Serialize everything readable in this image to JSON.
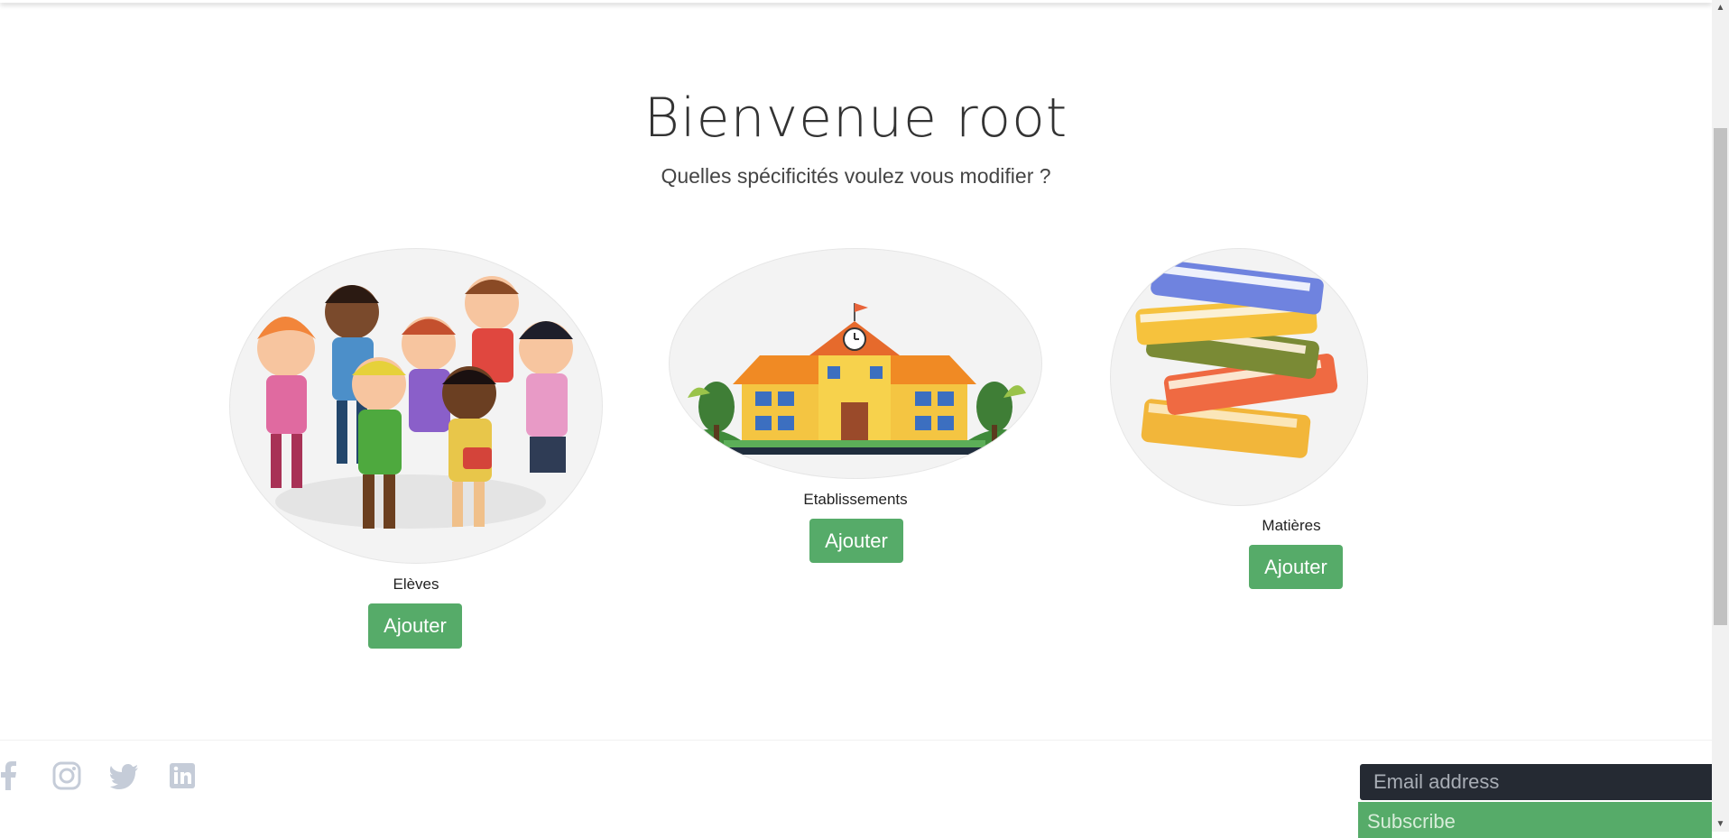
{
  "hero": {
    "title": "Bienvenue root",
    "subtitle": "Quelles spécificités voulez vous modifier ?"
  },
  "cards": [
    {
      "label": "Elèves",
      "button": "Ajouter",
      "illustration": "children-group-illustration"
    },
    {
      "label": "Etablissements",
      "button": "Ajouter",
      "illustration": "school-building-illustration"
    },
    {
      "label": "Matières",
      "button": "Ajouter",
      "illustration": "book-stack-illustration"
    }
  ],
  "footer": {
    "social": [
      "facebook-icon",
      "instagram-icon",
      "twitter-icon",
      "linkedin-icon"
    ],
    "email_placeholder": "Email address",
    "subscribe_label": "Subscribe"
  },
  "colors": {
    "accent_green": "#56ab69",
    "input_dark": "#252a33",
    "social_icon": "#c5ccd8"
  }
}
